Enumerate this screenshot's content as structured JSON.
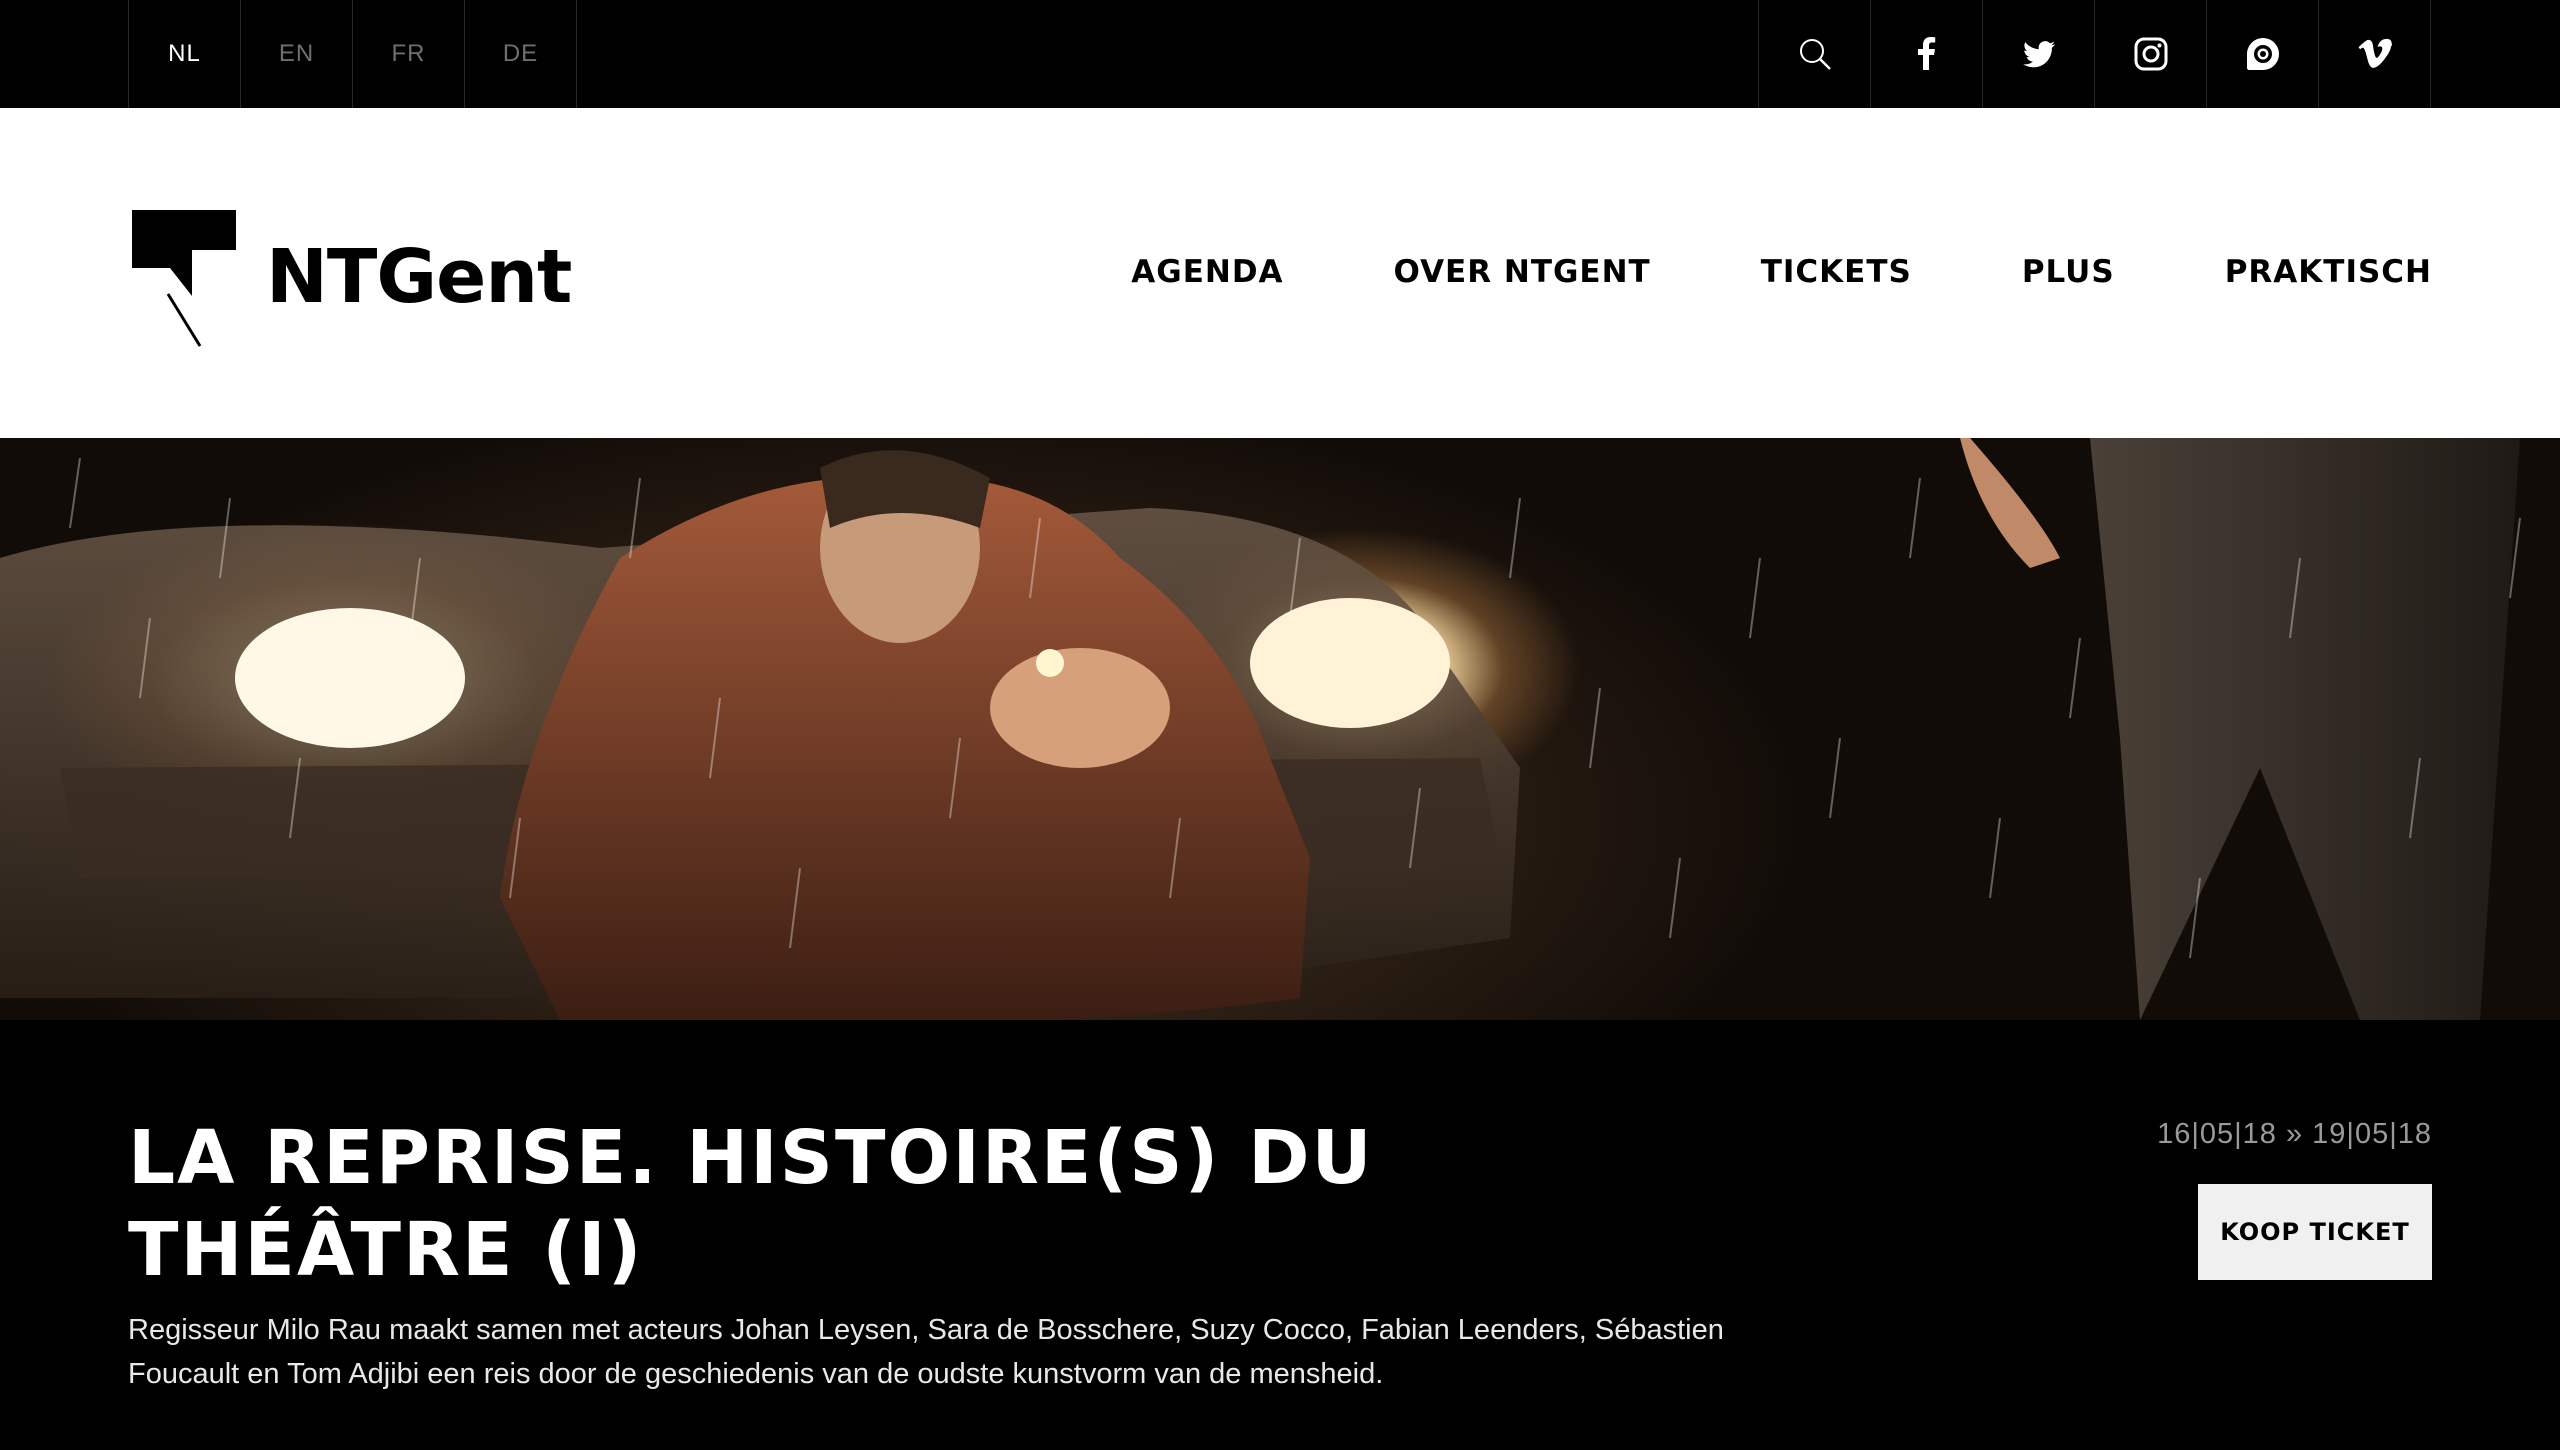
{
  "languages": [
    {
      "label": "NL",
      "active": true
    },
    {
      "label": "EN",
      "active": false
    },
    {
      "label": "FR",
      "active": false
    },
    {
      "label": "DE",
      "active": false
    }
  ],
  "social_icons": [
    "search-icon",
    "facebook-icon",
    "twitter-icon",
    "instagram-icon",
    "issuu-icon",
    "vimeo-icon"
  ],
  "brand": {
    "name": "NTGent"
  },
  "nav": {
    "items": [
      "AGENDA",
      "OVER NTGENT",
      "TICKETS",
      "PLUS",
      "PRAKTISCH"
    ]
  },
  "show": {
    "title": "LA REPRISE. HISTOIRE(S) DU THÉÂTRE (I)",
    "description": "Regisseur Milo Rau maakt samen met acteurs Johan Leysen, Sara de Bosschere, Suzy Cocco, Fabian Leenders, Sébastien Foucault en Tom Adjibi een reis door de geschiedenis van de oudste kunstvorm van de mensheid.",
    "dates": "16|05|18 » 19|05|18",
    "buy_label": "KOOP TICKET"
  },
  "colors": {
    "background": "#000000",
    "header": "#ffffff",
    "inactive_lang": "#6f6f6f",
    "dates": "#9a9a9a",
    "button_bg": "#f0f0f0"
  }
}
